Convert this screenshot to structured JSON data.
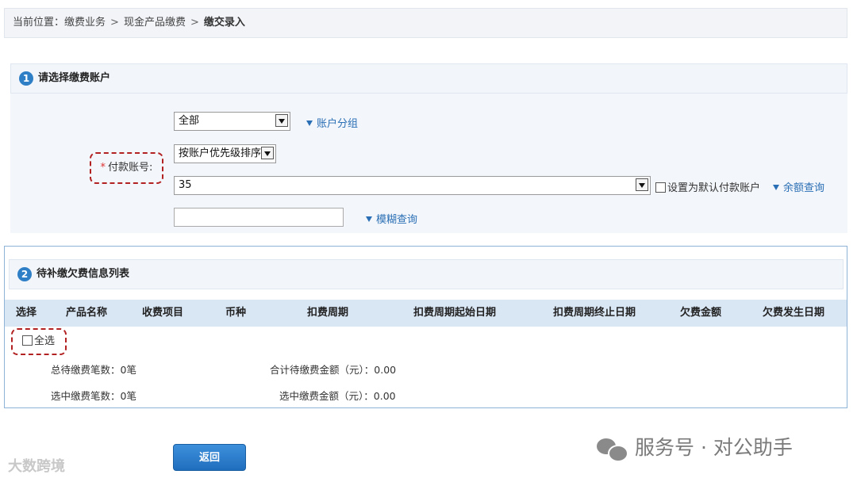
{
  "breadcrumb": {
    "prefix": "当前位置：",
    "items": [
      "缴费业务",
      "现金产品缴费",
      "缴交录入"
    ],
    "separator": ">"
  },
  "section1": {
    "number": "1",
    "title": "请选择缴费账户"
  },
  "form": {
    "required_mark": "*",
    "pay_account_label": "付款账号:",
    "group_select_value": "全部",
    "group_link": "账户分组",
    "sort_select_value": "按账户优先级排序",
    "account_select_value": "35",
    "default_account_label": "设置为默认付款账户",
    "balance_link": "余额查询",
    "fuzzy_input_value": "",
    "fuzzy_link": "模糊查询"
  },
  "section2": {
    "number": "2",
    "title": "待补缴欠费信息列表"
  },
  "table": {
    "columns": [
      "选择",
      "产品名称",
      "收费项目",
      "币种",
      "扣费周期",
      "扣费周期起始日期",
      "扣费周期终止日期",
      "欠费金额",
      "欠费发生日期"
    ],
    "select_all_label": "全选"
  },
  "summary": {
    "total_count_label": "总待缴费笔数：",
    "total_count_value": "0笔",
    "total_amount_label": "合计待缴费金额（元）：",
    "total_amount_value": "0.00",
    "selected_count_label": "选中缴费笔数：",
    "selected_count_value": "0笔",
    "selected_amount_label": "选中缴费金额（元）：",
    "selected_amount_value": "0.00"
  },
  "buttons": {
    "back": "返回"
  },
  "watermarks": {
    "left": "大数跨境",
    "right": "服务号 · 对公助手"
  },
  "colors": {
    "accent": "#2f7fc6",
    "link": "#2a6fb5",
    "highlight_dashed": "#b22222",
    "table_header_bg": "#d9e6f4"
  }
}
